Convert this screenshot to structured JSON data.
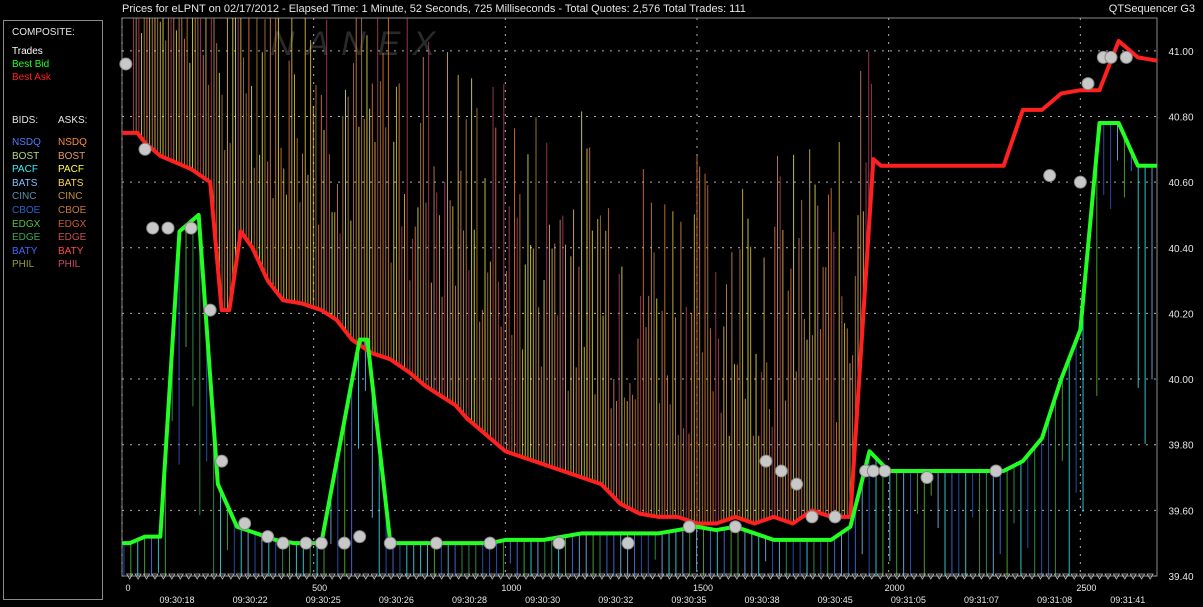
{
  "title": "Prices for  eLPNT  on  02/17/2012  -  Elapsed Time: 1 Minute, 52 Seconds, 725 Milliseconds  -  Total Quotes: 2,576  Total Trades: 111",
  "app_name": "QTSequencer G3",
  "watermark": "NANEX",
  "legend": {
    "composite_header": "COMPOSITE:",
    "composite": [
      {
        "label": "Trades",
        "color": "#ffffff"
      },
      {
        "label": "Best Bid",
        "color": "#22ff22"
      },
      {
        "label": "Best Ask",
        "color": "#ff2020"
      }
    ],
    "bids_header": "BIDS:",
    "asks_header": "ASKS:",
    "exchanges": [
      {
        "bid": "NSDQ",
        "ask": "NSDQ",
        "bid_color": "#4f7cff",
        "ask_color": "#ff8a3a"
      },
      {
        "bid": "BOST",
        "ask": "BOST",
        "bid_color": "#b6d68c",
        "ask_color": "#e79a6a"
      },
      {
        "bid": "PACF",
        "ask": "PACF",
        "bid_color": "#38f0ff",
        "ask_color": "#ffff50"
      },
      {
        "bid": "BATS",
        "ask": "BATS",
        "bid_color": "#80c4ff",
        "ask_color": "#ffd84a"
      },
      {
        "bid": "CINC",
        "ask": "CINC",
        "bid_color": "#5e8fb0",
        "ask_color": "#c8903c"
      },
      {
        "bid": "CBOE",
        "ask": "CBOE",
        "bid_color": "#2d5fd0",
        "ask_color": "#c67a3a"
      },
      {
        "bid": "EDGX",
        "ask": "EDGX",
        "bid_color": "#56c23a",
        "ask_color": "#c95a2a"
      },
      {
        "bid": "EDGE",
        "ask": "EDGE",
        "bid_color": "#3aa85a",
        "ask_color": "#c85050"
      },
      {
        "bid": "BATY",
        "ask": "BATY",
        "bid_color": "#4a64ff",
        "ask_color": "#ff4a4a"
      },
      {
        "bid": "PHIL",
        "ask": "PHIL",
        "bid_color": "#9a9a3c",
        "ask_color": "#c8486a"
      }
    ]
  },
  "chart_data": {
    "type": "line",
    "ylim": [
      39.4,
      41.1
    ],
    "xlim": [
      0,
      2700
    ],
    "y_ticks": [
      "41.00",
      "40.80",
      "40.60",
      "40.40",
      "40.20",
      "40.00",
      "39.80",
      "39.60",
      "39.40"
    ],
    "x_ticks": [
      "0",
      "500",
      "1000",
      "1500",
      "2000",
      "2500"
    ],
    "time_labels": [
      "09:30:18",
      "09:30:22",
      "09:30:25",
      "09:30:26",
      "09:30:28",
      "09:30:30",
      "09:30:32",
      "09:30:35",
      "09:30:38",
      "09:30:45",
      "09:31:05",
      "09:31:07",
      "09:31:08",
      "09:31:41"
    ],
    "grid": true,
    "series": [
      {
        "name": "Best Ask",
        "color": "#ff2020",
        "x": [
          0,
          40,
          60,
          100,
          140,
          180,
          230,
          260,
          280,
          310,
          340,
          380,
          420,
          470,
          520,
          560,
          600,
          650,
          700,
          750,
          790,
          830,
          870,
          900,
          960,
          1000,
          1050,
          1100,
          1150,
          1200,
          1250,
          1300,
          1350,
          1400,
          1450,
          1500,
          1550,
          1600,
          1650,
          1700,
          1750,
          1800,
          1850,
          1900,
          1960,
          1980,
          2000,
          2050,
          2100,
          2150,
          2200,
          2250,
          2300,
          2350,
          2400,
          2450,
          2500,
          2550,
          2600,
          2650,
          2700
        ],
        "y": [
          40.75,
          40.75,
          40.72,
          40.68,
          40.66,
          40.64,
          40.6,
          40.21,
          40.21,
          40.45,
          40.4,
          40.3,
          40.24,
          40.23,
          40.21,
          40.18,
          40.12,
          40.08,
          40.06,
          40.02,
          39.98,
          39.95,
          39.92,
          39.88,
          39.82,
          39.78,
          39.76,
          39.74,
          39.72,
          39.7,
          39.68,
          39.62,
          39.59,
          39.58,
          39.58,
          39.56,
          39.56,
          39.58,
          39.56,
          39.58,
          39.56,
          39.6,
          39.58,
          39.58,
          40.67,
          40.65,
          40.65,
          40.65,
          40.65,
          40.65,
          40.65,
          40.65,
          40.65,
          40.82,
          40.82,
          40.87,
          40.88,
          40.88,
          41.03,
          40.98,
          40.97
        ]
      },
      {
        "name": "Best Bid",
        "color": "#22ff22",
        "x": [
          0,
          20,
          60,
          100,
          150,
          200,
          250,
          300,
          350,
          400,
          450,
          520,
          620,
          640,
          700,
          750,
          800,
          850,
          900,
          960,
          1000,
          1050,
          1100,
          1150,
          1200,
          1250,
          1300,
          1350,
          1400,
          1450,
          1500,
          1550,
          1600,
          1650,
          1700,
          1800,
          1850,
          1900,
          1950,
          2000,
          2050,
          2100,
          2150,
          2200,
          2250,
          2300,
          2350,
          2400,
          2450,
          2500,
          2550,
          2600,
          2650,
          2700
        ],
        "y": [
          39.5,
          39.5,
          39.52,
          39.52,
          40.45,
          40.5,
          39.68,
          39.55,
          39.53,
          39.51,
          39.5,
          39.5,
          40.12,
          40.12,
          39.5,
          39.5,
          39.5,
          39.5,
          39.5,
          39.5,
          39.51,
          39.51,
          39.51,
          39.52,
          39.53,
          39.53,
          39.53,
          39.53,
          39.53,
          39.54,
          39.55,
          39.54,
          39.55,
          39.53,
          39.51,
          39.51,
          39.51,
          39.55,
          39.78,
          39.72,
          39.72,
          39.72,
          39.72,
          39.72,
          39.72,
          39.72,
          39.75,
          39.82,
          40.0,
          40.15,
          40.78,
          40.78,
          40.65,
          40.65
        ]
      },
      {
        "name": "Trades",
        "color": "#c8c8c8",
        "x": [
          10,
          60,
          80,
          120,
          180,
          230,
          260,
          320,
          380,
          420,
          480,
          520,
          580,
          620,
          700,
          820,
          960,
          1140,
          1320,
          1480,
          1600,
          1680,
          1720,
          1760,
          1800,
          1860,
          1940,
          1960,
          1990,
          2100,
          2280,
          2420,
          2500,
          2520,
          2560,
          2580,
          2620
        ],
        "y": [
          40.96,
          40.7,
          40.46,
          40.46,
          40.46,
          40.21,
          39.75,
          39.56,
          39.52,
          39.5,
          39.5,
          39.5,
          39.5,
          39.52,
          39.5,
          39.5,
          39.5,
          39.5,
          39.5,
          39.55,
          39.55,
          39.75,
          39.72,
          39.68,
          39.58,
          39.58,
          39.72,
          39.72,
          39.72,
          39.7,
          39.72,
          40.62,
          40.6,
          40.9,
          40.98,
          40.98,
          40.98
        ]
      }
    ]
  }
}
